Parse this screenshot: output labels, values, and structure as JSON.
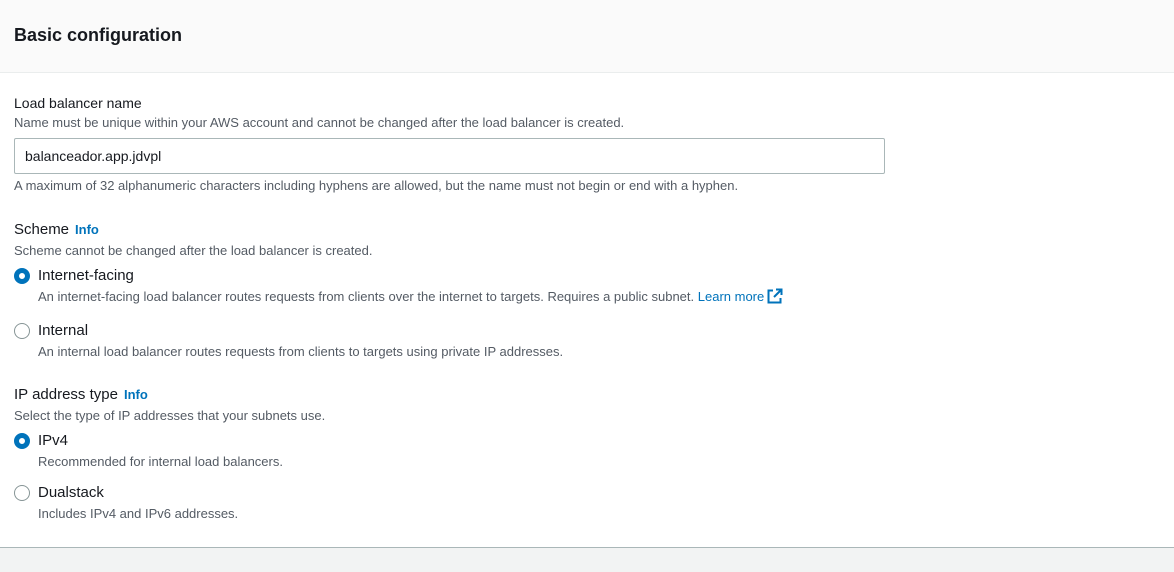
{
  "section": {
    "title": "Basic configuration"
  },
  "load_balancer_name": {
    "label": "Load balancer name",
    "description": "Name must be unique within your AWS account and cannot be changed after the load balancer is created.",
    "value": "balanceador.app.jdvpl",
    "constraint": "A maximum of 32 alphanumeric characters including hyphens are allowed, but the name must not begin or end with a hyphen."
  },
  "scheme": {
    "label": "Scheme",
    "info": "Info",
    "description": "Scheme cannot be changed after the load balancer is created.",
    "options": [
      {
        "label": "Internet-facing",
        "description": "An internet-facing load balancer routes requests from clients over the internet to targets. Requires a public subnet.",
        "link": "Learn more",
        "selected": true
      },
      {
        "label": "Internal",
        "description": "An internal load balancer routes requests from clients to targets using private IP addresses.",
        "selected": false
      }
    ]
  },
  "ip_address_type": {
    "label": "IP address type",
    "info": "Info",
    "description": "Select the type of IP addresses that your subnets use.",
    "options": [
      {
        "label": "IPv4",
        "description": "Recommended for internal load balancers.",
        "selected": true
      },
      {
        "label": "Dualstack",
        "description": "Includes IPv4 and IPv6 addresses.",
        "selected": false
      }
    ]
  },
  "colors": {
    "accent": "#0073bb",
    "text": "#16191f",
    "secondary_text": "#545b64",
    "border": "#aab7b8"
  },
  "icons": {
    "external_link": "external-link-icon"
  }
}
